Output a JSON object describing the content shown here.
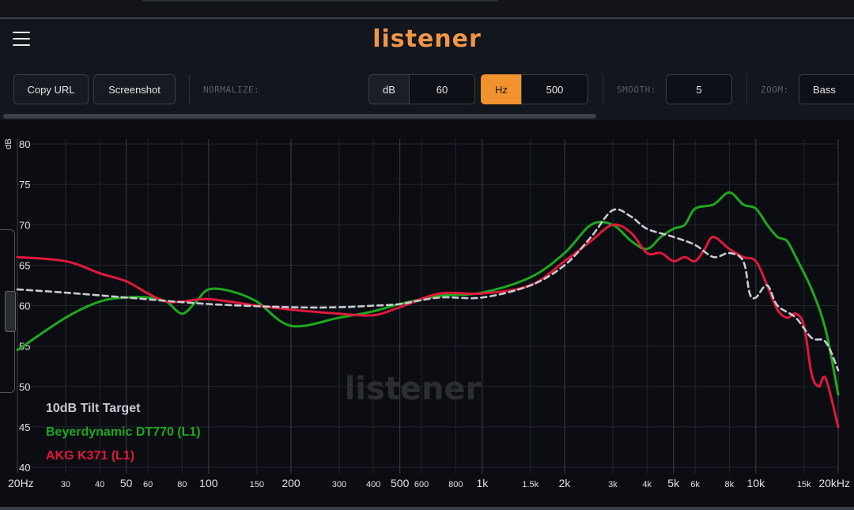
{
  "header": {
    "logo": "listener"
  },
  "toolbar": {
    "copy_url": "Copy URL",
    "screenshot": "Screenshot",
    "normalize_label": "NORMALIZE:",
    "db_unit": "dB",
    "db_value": "60",
    "hz_unit": "Hz",
    "hz_value": "500",
    "smooth_label": "SMOOTH:",
    "smooth_value": "5",
    "zoom_label": "ZOOM:",
    "zoom_value": "Bass"
  },
  "colors": {
    "accent": "#f0922e",
    "target": "#c8ccd2",
    "green": "#1fa81f",
    "red": "#e0193a"
  },
  "chart_data": {
    "type": "line",
    "x_scale": "log",
    "xlim": [
      20,
      20000
    ],
    "ylim": [
      40,
      80
    ],
    "ylabel": "dB",
    "y_ticks": [
      40,
      45,
      50,
      55,
      60,
      65,
      70,
      75,
      80
    ],
    "x_ticks": [
      {
        "v": 20,
        "t": "20Hz",
        "major": true
      },
      {
        "v": 30,
        "t": "30",
        "major": false
      },
      {
        "v": 40,
        "t": "40",
        "major": false
      },
      {
        "v": 50,
        "t": "50",
        "major": true
      },
      {
        "v": 60,
        "t": "60",
        "major": false
      },
      {
        "v": 80,
        "t": "80",
        "major": false
      },
      {
        "v": 100,
        "t": "100",
        "major": true
      },
      {
        "v": 150,
        "t": "150",
        "major": false
      },
      {
        "v": 200,
        "t": "200",
        "major": true
      },
      {
        "v": 300,
        "t": "300",
        "major": false
      },
      {
        "v": 400,
        "t": "400",
        "major": false
      },
      {
        "v": 500,
        "t": "500",
        "major": true
      },
      {
        "v": 600,
        "t": "600",
        "major": false
      },
      {
        "v": 800,
        "t": "800",
        "major": false
      },
      {
        "v": 1000,
        "t": "1k",
        "major": true
      },
      {
        "v": 1500,
        "t": "1.5k",
        "major": false
      },
      {
        "v": 2000,
        "t": "2k",
        "major": true
      },
      {
        "v": 3000,
        "t": "3k",
        "major": false
      },
      {
        "v": 4000,
        "t": "4k",
        "major": false
      },
      {
        "v": 5000,
        "t": "5k",
        "major": true
      },
      {
        "v": 6000,
        "t": "6k",
        "major": false
      },
      {
        "v": 8000,
        "t": "8k",
        "major": false
      },
      {
        "v": 10000,
        "t": "10k",
        "major": true
      },
      {
        "v": 15000,
        "t": "15k",
        "major": false
      },
      {
        "v": 20000,
        "t": "20kHz",
        "major": true
      }
    ],
    "watermark": "listener",
    "series": [
      {
        "name": "10dB Tilt Target",
        "color": "#c8ccd2",
        "dashed": true,
        "x": [
          20,
          30,
          50,
          100,
          200,
          300,
          400,
          500,
          700,
          1000,
          1500,
          2000,
          2500,
          3000,
          3500,
          4000,
          5000,
          6000,
          7000,
          8000,
          9000,
          9500,
          10000,
          11000,
          12000,
          14000,
          16000,
          18000,
          20000
        ],
        "y": [
          62,
          61.6,
          61,
          60.2,
          59.8,
          59.8,
          60,
          60.2,
          61,
          61,
          62.5,
          65,
          68.5,
          71.8,
          71,
          69.5,
          68.5,
          67.5,
          66,
          66.5,
          65.5,
          61.5,
          61,
          62.5,
          60,
          58.5,
          56,
          55.5,
          52
        ]
      },
      {
        "name": "Beyerdynamic DT770 (L1)",
        "color": "#1fa81f",
        "dashed": false,
        "x": [
          20,
          30,
          40,
          50,
          60,
          70,
          80,
          90,
          100,
          120,
          150,
          200,
          300,
          400,
          500,
          700,
          1000,
          1500,
          2000,
          2500,
          3000,
          3500,
          4000,
          4500,
          5000,
          5500,
          6000,
          7000,
          8000,
          9000,
          10000,
          11000,
          12000,
          13000,
          14000,
          16000,
          18000,
          20000
        ],
        "y": [
          54.5,
          58.5,
          60.5,
          61,
          61,
          60.5,
          59,
          60.5,
          62,
          61.8,
          60.5,
          57.5,
          58.5,
          59.3,
          60.2,
          61.2,
          61.6,
          63.5,
          66.5,
          70,
          70,
          68,
          67,
          68.5,
          69.5,
          70,
          72,
          72.5,
          74,
          72.5,
          72,
          70,
          68.5,
          68,
          66,
          62,
          57,
          49
        ]
      },
      {
        "name": "AKG K371 (L1)",
        "color": "#e0193a",
        "dashed": false,
        "x": [
          20,
          30,
          40,
          50,
          60,
          70,
          80,
          100,
          150,
          200,
          300,
          400,
          500,
          700,
          1000,
          1500,
          2000,
          2500,
          3000,
          3500,
          4000,
          4500,
          5000,
          5500,
          6000,
          6500,
          7000,
          8000,
          9000,
          10000,
          11000,
          12000,
          13000,
          14000,
          15000,
          16000,
          17000,
          18000,
          20000
        ],
        "y": [
          66,
          65.5,
          64,
          63,
          61.5,
          60.5,
          60.5,
          60.8,
          60,
          59.5,
          59,
          58.8,
          59.8,
          61.5,
          61.5,
          62.5,
          65.5,
          68,
          70,
          69,
          66.5,
          66.5,
          65.5,
          66,
          65.5,
          67,
          68.5,
          67,
          66,
          65.5,
          62.5,
          59.5,
          58.5,
          59,
          57.5,
          51.5,
          50,
          51,
          45
        ]
      }
    ]
  }
}
